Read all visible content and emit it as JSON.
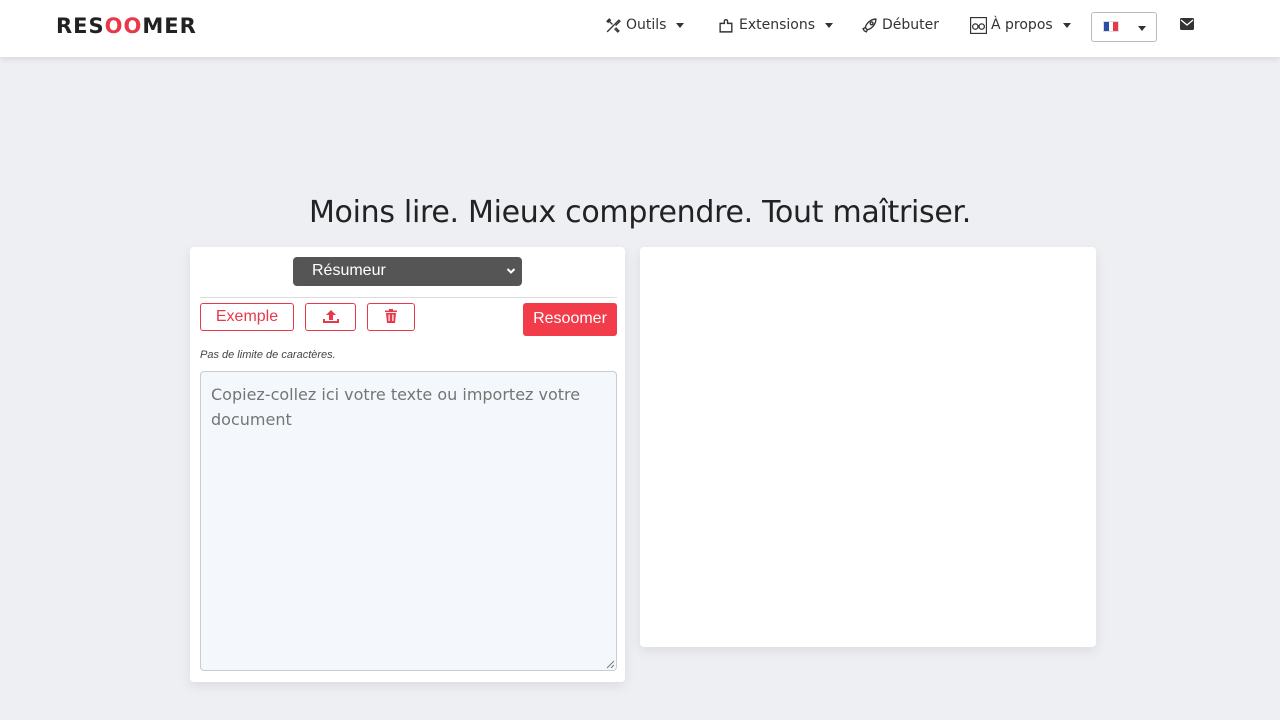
{
  "navbar": {
    "logo": {
      "part1": "RES",
      "part2": "OO",
      "part3": "MER"
    },
    "items": [
      {
        "label": "Outils",
        "icon": "tools-icon"
      },
      {
        "label": "Extensions",
        "icon": "puzzle-icon"
      },
      {
        "label": "Débuter",
        "icon": "rocket-icon"
      },
      {
        "label": "À propos",
        "icon": "glasses-icon"
      }
    ],
    "language_flag": "fr-flag-icon",
    "contact_icon": "mail-icon"
  },
  "headline": "Moins lire. Mieux comprendre. Tout maîtriser.",
  "editor": {
    "mode": "Résumeur",
    "buttons": {
      "example": "Exemple",
      "upload_icon": "upload-icon",
      "delete_icon": "trash-icon",
      "submit": "Resoomer"
    },
    "hint": "Pas de limite de caractères.",
    "placeholder": "Copiez-collez ici votre texte ou importez votre document",
    "value": ""
  },
  "colors": {
    "accent": "#e8394a",
    "primary_button": "#f23c4a",
    "background": "#eeeff3",
    "select_bg": "#555555"
  }
}
